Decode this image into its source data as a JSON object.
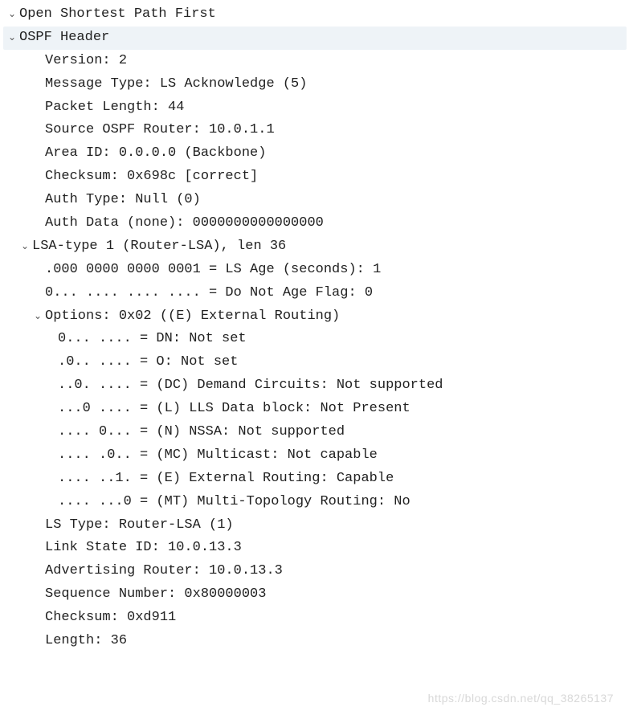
{
  "root": {
    "label": "Open Shortest Path First"
  },
  "ospf_header": {
    "label": "OSPF Header",
    "version": "Version: 2",
    "msg_type": "Message Type: LS Acknowledge (5)",
    "pkt_len": "Packet Length: 44",
    "src_router": "Source OSPF Router: 10.0.1.1",
    "area_id": "Area ID: 0.0.0.0 (Backbone)",
    "checksum": "Checksum: 0x698c [correct]",
    "auth_type": "Auth Type: Null (0)",
    "auth_data": "Auth Data (none): 0000000000000000"
  },
  "lsa": {
    "label": "LSA-type 1 (Router-LSA), len 36",
    "ls_age": ".000 0000 0000 0001 = LS Age (seconds): 1",
    "dna_flag": "0... .... .... .... = Do Not Age Flag: 0",
    "options_label": "Options: 0x02 ((E) External Routing)",
    "opt_dn": "0... .... = DN: Not set",
    "opt_o": ".0.. .... = O: Not set",
    "opt_dc": "..0. .... = (DC) Demand Circuits: Not supported",
    "opt_l": "...0 .... = (L) LLS Data block: Not Present",
    "opt_n": ".... 0... = (N) NSSA: Not supported",
    "opt_mc": ".... .0.. = (MC) Multicast: Not capable",
    "opt_e": ".... ..1. = (E) External Routing: Capable",
    "opt_mt": ".... ...0 = (MT) Multi-Topology Routing: No",
    "ls_type": "LS Type: Router-LSA (1)",
    "link_state_id": "Link State ID: 10.0.13.3",
    "adv_router": "Advertising Router: 10.0.13.3",
    "seq_num": "Sequence Number: 0x80000003",
    "checksum": "Checksum: 0xd911",
    "length": "Length: 36"
  },
  "watermark": "https://blog.csdn.net/qq_38265137"
}
